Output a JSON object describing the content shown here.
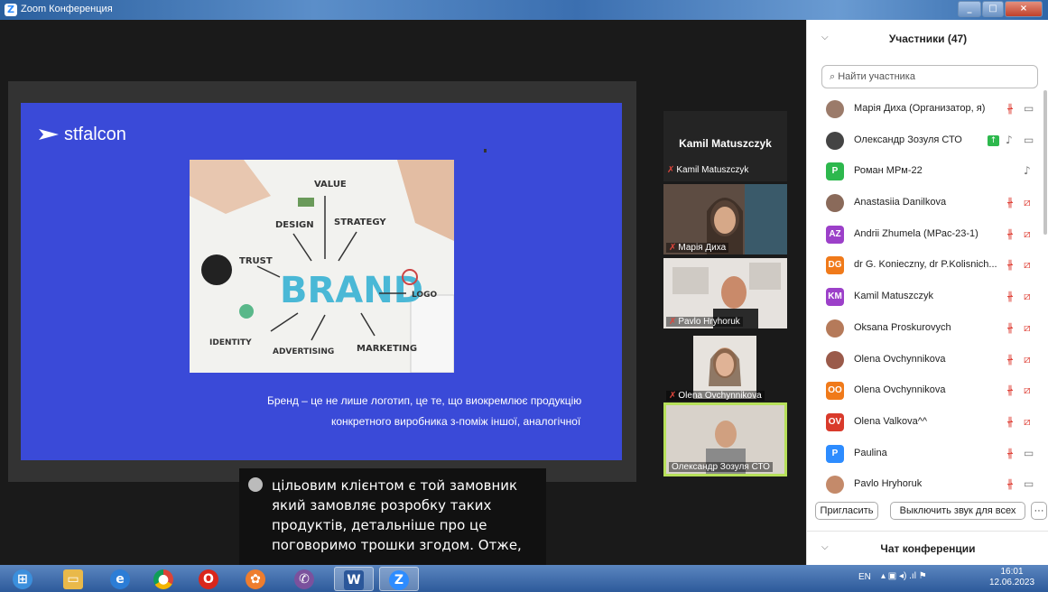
{
  "window": {
    "title": "Zoom Конференция",
    "colors": {
      "accent": "#2d8cff"
    }
  },
  "slide": {
    "logo": "stfalcon",
    "image_words": [
      "VALUE",
      "DESIGN",
      "STRATEGY",
      "TRUST",
      "BRAND",
      "LOGO",
      "IDENTITY",
      "ADVERTISING",
      "MARKETING"
    ],
    "caption_line1": "Бренд – це не лише логотип, це те, що виокремлює продукцію",
    "caption_line2": "конкретного виробника з-поміж іншої, аналогічної"
  },
  "videos": {
    "active_speaker_big": "Kamil Matuszczyk",
    "active_speaker_small": "Kamil Matuszczyk",
    "tiles": [
      {
        "name": "Марія Диха",
        "muted": true
      },
      {
        "name": "Pavlo Hryhoruk",
        "muted": true
      },
      {
        "name": "Olena Ovchynnikova",
        "muted": true
      },
      {
        "name": "Олександр Зозуля СТО",
        "muted": false
      }
    ]
  },
  "captions": {
    "text": "цільовим клієнтом є той замовник який замовляє розробку таких продуктів, детальніше про це поговоримо трошки згодом. Отже,"
  },
  "participants": {
    "header": "Участники (47)",
    "search_placeholder": "Найти участника",
    "list": [
      {
        "initials": "",
        "color": "#9b7b6a",
        "name": "Марія Диха (Организатор, я)",
        "mic": "muted",
        "video": "on"
      },
      {
        "initials": "",
        "color": "#444444",
        "name": "Олександр Зозуля СТО",
        "mic": "on",
        "video": "on",
        "sharing": true
      },
      {
        "initials": "P",
        "color": "#2db84d",
        "name": "Роман МРм-22",
        "mic": "on-only"
      },
      {
        "initials": "",
        "color": "#8a6a5a",
        "name": "Anastasiia Danilkova",
        "mic": "muted",
        "video": "off"
      },
      {
        "initials": "AZ",
        "color": "#9c40c9",
        "name": "Andrii Zhumela (МРас-23-1)",
        "mic": "muted",
        "video": "off"
      },
      {
        "initials": "DG",
        "color": "#f07a1a",
        "name": "dr G. Konieczny, dr P.Kolisnich...",
        "mic": "muted",
        "video": "off"
      },
      {
        "initials": "KM",
        "color": "#9c40c9",
        "name": "Kamil Matuszczyk",
        "mic": "muted",
        "video": "off"
      },
      {
        "initials": "",
        "color": "#b57a5a",
        "name": "Oksana Proskurovych",
        "mic": "muted",
        "video": "off"
      },
      {
        "initials": "",
        "color": "#9a5a4a",
        "name": "Olena Ovchynnikova",
        "mic": "muted",
        "video": "off"
      },
      {
        "initials": "OO",
        "color": "#f07a1a",
        "name": "Olena Ovchynnikova",
        "mic": "muted",
        "video": "off"
      },
      {
        "initials": "OV",
        "color": "#d93a2b",
        "name": "Olena Valkova^^",
        "mic": "muted",
        "video": "off"
      },
      {
        "initials": "P",
        "color": "#2d8cff",
        "name": "Paulina",
        "mic": "muted",
        "video": "on"
      },
      {
        "initials": "",
        "color": "#c48a6a",
        "name": "Pavlo Hryhoruk",
        "mic": "muted",
        "video": "on"
      }
    ],
    "invite_label": "Пригласить",
    "mute_all_label": "Выключить звук для всех",
    "more_label": "···",
    "chat_header": "Чат конференции"
  },
  "taskbar": {
    "lang": "EN",
    "time": "16:01",
    "date": "12.06.2023",
    "apps": [
      "windows-start",
      "file-explorer",
      "internet-explorer",
      "chrome",
      "opera",
      "app-orange",
      "viber",
      "word",
      "zoom"
    ]
  }
}
